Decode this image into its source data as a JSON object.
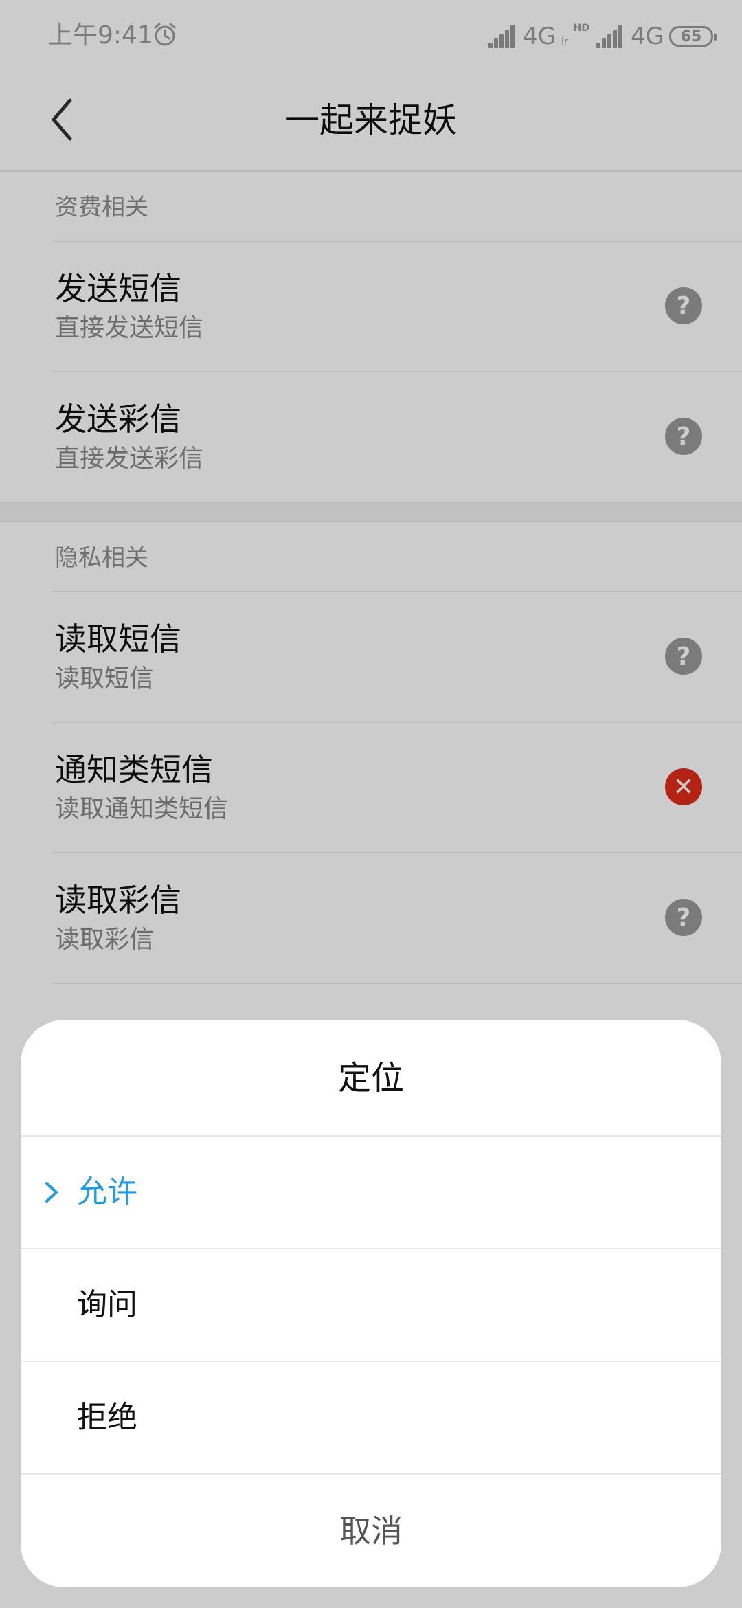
{
  "status_bar": {
    "time": "上午9:41",
    "network1": "4G",
    "network1_small": "lr",
    "hd": "HD",
    "network2": "4G",
    "battery": "65"
  },
  "header": {
    "title": "一起来捉妖"
  },
  "sections": [
    {
      "label": "资费相关",
      "items": [
        {
          "title": "发送短信",
          "subtitle": "直接发送短信",
          "status": "ask-icon"
        },
        {
          "title": "发送彩信",
          "subtitle": "直接发送彩信",
          "status": "ask-icon"
        }
      ]
    },
    {
      "label": "隐私相关",
      "items": [
        {
          "title": "读取短信",
          "subtitle": "读取短信",
          "status": "ask-icon"
        },
        {
          "title": "通知类短信",
          "subtitle": "读取通知类短信",
          "status": "deny-icon"
        },
        {
          "title": "读取彩信",
          "subtitle": "读取彩信",
          "status": "ask-icon"
        }
      ]
    }
  ],
  "dialog": {
    "title": "定位",
    "options": [
      {
        "label": "允许",
        "selected": true
      },
      {
        "label": "询问",
        "selected": false
      },
      {
        "label": "拒绝",
        "selected": false
      }
    ],
    "cancel": "取消"
  },
  "colors": {
    "accent": "#1f9be8",
    "deny": "#e02d1b",
    "ask": "#9a9a9a",
    "overlay": "rgba(0,0,0,0.2)"
  }
}
